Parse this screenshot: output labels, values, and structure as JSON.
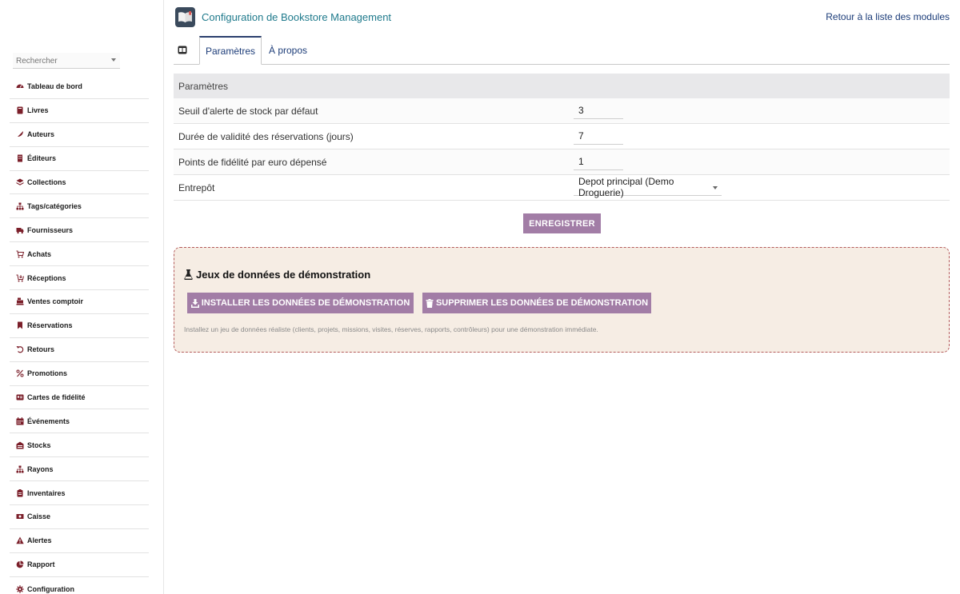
{
  "header": {
    "title": "Configuration de Bookstore Management",
    "back_link": "Retour à la liste des modules"
  },
  "sidebar": {
    "search_placeholder": "Rechercher",
    "items": [
      {
        "label": "Tableau de bord",
        "icon": "dashboard-icon"
      },
      {
        "label": "Livres",
        "icon": "book-icon"
      },
      {
        "label": "Auteurs",
        "icon": "feather-icon"
      },
      {
        "label": "Éditeurs",
        "icon": "building-icon"
      },
      {
        "label": "Collections",
        "icon": "layers-icon"
      },
      {
        "label": "Tags/catégories",
        "icon": "sitemap-icon"
      },
      {
        "label": "Fournisseurs",
        "icon": "truck-icon"
      },
      {
        "label": "Achats",
        "icon": "cart-icon"
      },
      {
        "label": "Réceptions",
        "icon": "cart-arrow-icon"
      },
      {
        "label": "Ventes comptoir",
        "icon": "cash-register-icon"
      },
      {
        "label": "Réservations",
        "icon": "bookmark-icon"
      },
      {
        "label": "Retours",
        "icon": "undo-icon"
      },
      {
        "label": "Promotions",
        "icon": "percent-icon"
      },
      {
        "label": "Cartes de fidélité",
        "icon": "id-card-icon"
      },
      {
        "label": "Événements",
        "icon": "calendar-icon"
      },
      {
        "label": "Stocks",
        "icon": "warehouse-icon"
      },
      {
        "label": "Rayons",
        "icon": "shelves-icon"
      },
      {
        "label": "Inventaires",
        "icon": "clipboard-icon"
      },
      {
        "label": "Caisse",
        "icon": "money-icon"
      },
      {
        "label": "Alertes",
        "icon": "warning-icon"
      },
      {
        "label": "Rapport",
        "icon": "pie-chart-icon"
      },
      {
        "label": "Configuration",
        "icon": "gear-icon"
      }
    ]
  },
  "tabs": {
    "active": "Paramètres",
    "about": "À propos"
  },
  "settings": {
    "heading": "Paramètres",
    "stock_alert_label": "Seuil d'alerte de stock par défaut",
    "stock_alert_value": "3",
    "reservation_label": "Durée de validité des réservations (jours)",
    "reservation_value": "7",
    "fidelity_label": "Points de fidélité par euro dépensé",
    "fidelity_value": "1",
    "warehouse_label": "Entrepôt",
    "warehouse_value": "Depot principal (Demo Droguerie)",
    "save_label": "ENREGISTRER"
  },
  "demo": {
    "title": "Jeux de données de démonstration",
    "install_label": "INSTALLER LES DONNÉES DE DÉMONSTRATION",
    "delete_label": "SUPPRIMER LES DONNÉES DE DÉMONSTRATION",
    "note": "Installez un jeu de données réaliste (clients, projets, missions, visites, réserves, rapports, contrôleurs) pour une démonstration immédiate."
  },
  "colors": {
    "accent_button": "#a27da6",
    "sidebar_icon": "#7b1f2a",
    "title_teal": "#1f7a8c",
    "demo_background": "#f6ede4",
    "demo_border": "#b45a5a"
  }
}
